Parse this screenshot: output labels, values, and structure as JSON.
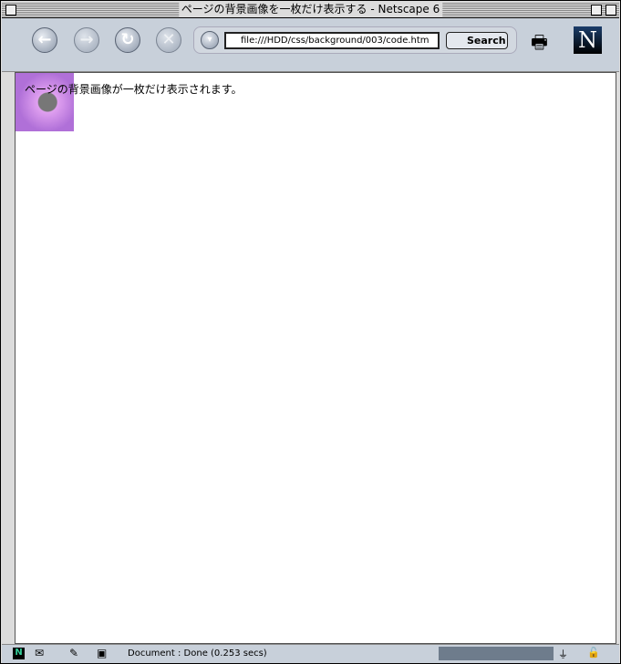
{
  "window": {
    "title": "ページの背景画像を一枚だけ表示する - Netscape 6"
  },
  "toolbar": {
    "back": "←",
    "forward": "→",
    "reload": "↻",
    "stop": "✕",
    "url": "file:///HDD/css/background/003/code.htm",
    "search_label": "Search",
    "logo": "N"
  },
  "page": {
    "text": "ページの背景画像が一枚だけ表示されます。"
  },
  "status": {
    "message": "Document : Done (0.253 secs)"
  }
}
